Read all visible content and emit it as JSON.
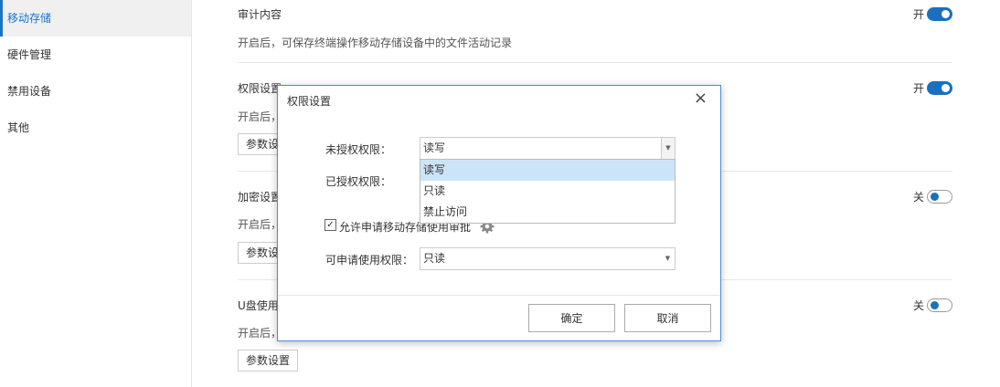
{
  "sidebar": {
    "items": [
      {
        "label": "移动存储",
        "active": true
      },
      {
        "label": "硬件管理"
      },
      {
        "label": "禁用设备"
      },
      {
        "label": "其他"
      }
    ]
  },
  "sections": {
    "audit": {
      "title": "审计内容",
      "desc": "开启后，可保存终端操作移动存储设备中的文件活动记录",
      "toggle_label": "开"
    },
    "permission": {
      "title": "权限设置",
      "desc": "开启后，",
      "button": "参数设置",
      "toggle_label": "开"
    },
    "encrypt": {
      "title": "加密设置",
      "desc": "开启后，",
      "button": "参数设置",
      "toggle_label": "关"
    },
    "usb": {
      "title": "U盘使用",
      "desc": "开启后，",
      "button": "参数设置",
      "toggle_label": "关"
    }
  },
  "dialog": {
    "title": "权限设置",
    "close": "×",
    "unauthorized_label": "未授权权限：",
    "unauthorized_value": "读写",
    "authorized_label": "已授权权限：",
    "dropdown_options": [
      "读写",
      "只读",
      "禁止访问"
    ],
    "allow_apply_label": "允许申请移动存储使用审批",
    "applicable_label": "可申请使用权限：",
    "applicable_value": "只读",
    "confirm": "确定",
    "cancel": "取消"
  },
  "colors": {
    "accent": "#1a6fc0",
    "selected_option": "#cce4f7",
    "dialog_border": "#4a8fd6"
  }
}
